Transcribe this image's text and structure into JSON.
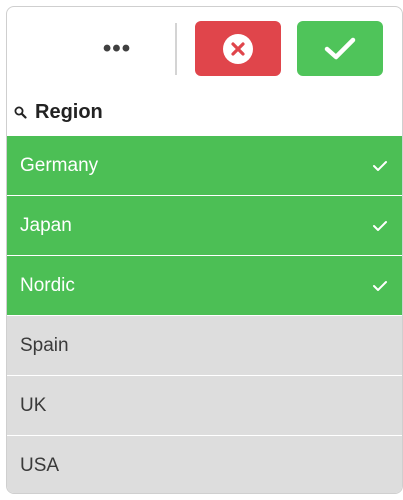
{
  "toolbar": {
    "more_label": "•••",
    "cancel_icon": "close-circle-icon",
    "confirm_icon": "checkmark-icon"
  },
  "field": {
    "search_icon": "search-icon",
    "name": "Region"
  },
  "values": [
    {
      "label": "Germany",
      "state": "selected"
    },
    {
      "label": "Japan",
      "state": "selected"
    },
    {
      "label": "Nordic",
      "state": "selected"
    },
    {
      "label": "Spain",
      "state": "possible"
    },
    {
      "label": "UK",
      "state": "possible"
    },
    {
      "label": "USA",
      "state": "possible"
    }
  ],
  "colors": {
    "selected": "#4cbf55",
    "possible": "#dddddd",
    "cancel": "#e0454b",
    "confirm": "#4fc45a"
  }
}
